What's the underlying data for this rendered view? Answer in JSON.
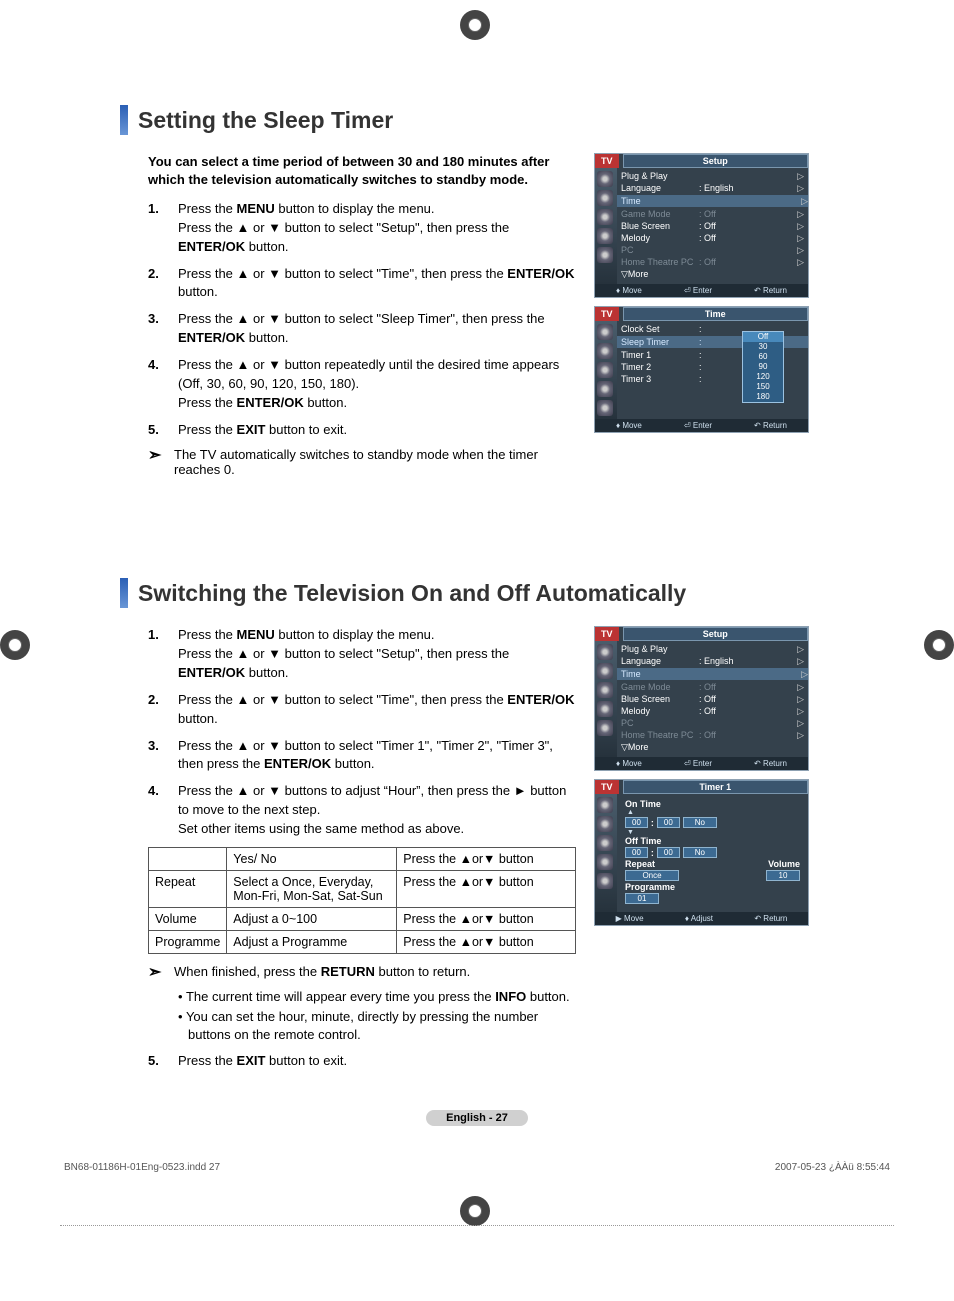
{
  "section1": {
    "title": "Setting the Sleep Timer",
    "intro": "You can select a time period of between 30 and 180 minutes after which the television automatically switches to standby mode.",
    "steps": [
      {
        "num": "1.",
        "body": "Press the <b>MENU</b> button to display the menu.<br>Press the ▲ or ▼ button to select \"Setup\", then press the <b>ENTER/OK</b> button."
      },
      {
        "num": "2.",
        "body": "Press the ▲ or ▼ button to select \"Time\", then press the <b>ENTER/OK</b> button."
      },
      {
        "num": "3.",
        "body": "Press the ▲ or ▼ button to select \"Sleep Timer\", then press the <b>ENTER/OK</b> button."
      },
      {
        "num": "4.",
        "body": "Press the ▲ or ▼ button repeatedly until the desired time appears (Off, 30, 60, 90, 120, 150, 180).<br>Press the <b>ENTER/OK</b> button."
      },
      {
        "num": "5.",
        "body": "Press the <b>EXIT</b> button to exit."
      }
    ],
    "note": "The TV automatically switches to standby mode when the timer reaches 0."
  },
  "section2": {
    "title": "Switching the Television On and Off Automatically",
    "steps": [
      {
        "num": "1.",
        "body": "Press the <b>MENU</b> button to display the menu.<br>Press the ▲ or ▼ button to select \"Setup\", then press the <b>ENTER/OK</b> button."
      },
      {
        "num": "2.",
        "body": "Press the ▲ or ▼ button to select \"Time\", then press the <b>ENTER/OK</b> button."
      },
      {
        "num": "3.",
        "body": "Press the ▲ or ▼ button to select \"Timer 1\", \"Timer 2\", \"Timer 3\", then press the <b>ENTER/OK</b> button."
      },
      {
        "num": "4.",
        "body": "Press the ▲ or ▼ buttons to adjust “Hour”, then press the ► button to move to the next step.<br>Set other items using the same method as above."
      }
    ],
    "table": [
      {
        "left": "",
        "mid": "Yes/ No",
        "right": "Press the ▲or▼ button"
      },
      {
        "left": "Repeat",
        "mid": "Select a Once, Everyday, Mon-Fri, Mon-Sat, Sat-Sun",
        "right": "Press the ▲or▼ button"
      },
      {
        "left": "Volume",
        "mid": "Adjust a 0~100",
        "right": "Press the ▲or▼ button"
      },
      {
        "left": "Programme",
        "mid": "Adjust a Programme",
        "right": "Press the ▲or▼ button"
      }
    ],
    "note": "When finished, press the <b>RETURN</b> button to return.",
    "bullets": [
      "The current time will appear every time you press the <b>INFO</b> button.",
      "You can set the hour, minute, directly by pressing the number buttons on the remote control."
    ],
    "step5": {
      "num": "5.",
      "body": "Press the <b>EXIT</b> button to exit."
    }
  },
  "osd_setup": {
    "tv": "TV",
    "title": "Setup",
    "rows": [
      {
        "lbl": "Plug & Play",
        "val": "",
        "arr": "▷"
      },
      {
        "lbl": "Language",
        "val": ": English",
        "arr": "▷"
      },
      {
        "lbl": "Time",
        "val": "",
        "arr": "▷",
        "hl": true
      },
      {
        "lbl": "Game Mode",
        "val": ": Off",
        "arr": "▷",
        "dim": true
      },
      {
        "lbl": "Blue Screen",
        "val": ": Off",
        "arr": "▷"
      },
      {
        "lbl": "Melody",
        "val": ": Off",
        "arr": "▷"
      },
      {
        "lbl": "PC",
        "val": "",
        "arr": "▷",
        "dim": true
      },
      {
        "lbl": "Home Theatre PC",
        "val": ": Off",
        "arr": "▷",
        "dim": true
      },
      {
        "lbl": "▽More",
        "val": "",
        "arr": ""
      }
    ],
    "footer": {
      "move": "Move",
      "enter": "Enter",
      "ret": "Return"
    }
  },
  "osd_time": {
    "tv": "TV",
    "title": "Time",
    "rows": [
      {
        "lbl": "Clock Set",
        "val": ":"
      },
      {
        "lbl": "Sleep Timer",
        "val": ":",
        "hl": true
      },
      {
        "lbl": "Timer 1",
        "val": ":"
      },
      {
        "lbl": "Timer 2",
        "val": ":"
      },
      {
        "lbl": "Timer 3",
        "val": ":"
      }
    ],
    "dropdown": [
      "Off",
      "30",
      "60",
      "90",
      "120",
      "150",
      "180"
    ],
    "footer": {
      "move": "Move",
      "enter": "Enter",
      "ret": "Return"
    }
  },
  "osd_timer1": {
    "tv": "TV",
    "title": "Timer 1",
    "on_time": "On Time",
    "off_time": "Off Time",
    "hh1": "00",
    "mm1": "00",
    "no1": "No",
    "hh2": "00",
    "mm2": "00",
    "no2": "No",
    "repeat": "Repeat",
    "volume": "Volume",
    "once": "Once",
    "vol": "10",
    "programme": "Programme",
    "prog": "01",
    "footer": {
      "move": "Move",
      "adjust": "Adjust",
      "ret": "Return"
    }
  },
  "footer": {
    "page": "English - 27",
    "file": "BN68-01186H-01Eng-0523.indd   27",
    "date": "2007-05-23   ¿ÀÀü 8:55:44"
  }
}
